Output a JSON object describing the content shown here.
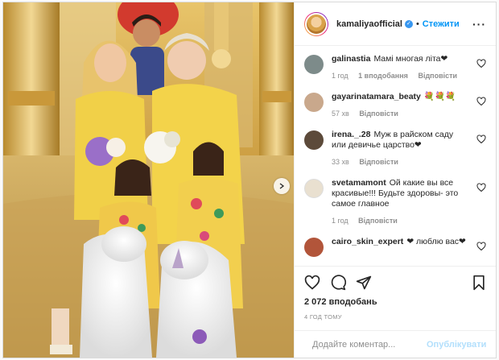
{
  "header": {
    "username": "kamaliyaofficial",
    "separator": "•",
    "follow_label": "Стежити",
    "more_label": "···"
  },
  "comments": [
    {
      "user": "galinastia",
      "text": "Мамі многая літа❤",
      "time": "1 год",
      "likes": "1 вподобання",
      "reply": "Відповісти",
      "avatar_color": "#7d8b8a"
    },
    {
      "user": "gayarinatamara_beaty",
      "text": "💐💐💐",
      "time": "57 хв",
      "likes": "",
      "reply": "Відповісти",
      "avatar_color": "#c9a88c"
    },
    {
      "user": "irena._.28",
      "text": "Муж в райском саду или девичье царство❤",
      "time": "33 хв",
      "likes": "",
      "reply": "Відповісти",
      "avatar_color": "#5c4a3a"
    },
    {
      "user": "svetamamont",
      "text": "Ой какие вы все красивые!!! Будьте здоровы- это самое главное",
      "time": "1 год",
      "likes": "",
      "reply": "Відповісти",
      "avatar_color": "#e9e0d0"
    },
    {
      "user": "cairo_skin_expert",
      "text": "❤ люблю вас❤",
      "time": "",
      "likes": "",
      "reply": "",
      "avatar_color": "#b2553a"
    }
  ],
  "likes_count": "2 072 вподобань",
  "timestamp": "4 ГОД ТОМУ",
  "add_comment": {
    "placeholder": "Додайте коментар...",
    "publish_label": "Опублікувати"
  },
  "icons": [
    "heart-icon",
    "comment-icon",
    "share-icon",
    "bookmark-icon",
    "emoji-icon",
    "next-arrow-icon",
    "more-icon",
    "verified-icon"
  ],
  "colors": {
    "accent": "#0095f6",
    "publish_disabled": "#b2dffc",
    "border": "#dbdbdb"
  }
}
